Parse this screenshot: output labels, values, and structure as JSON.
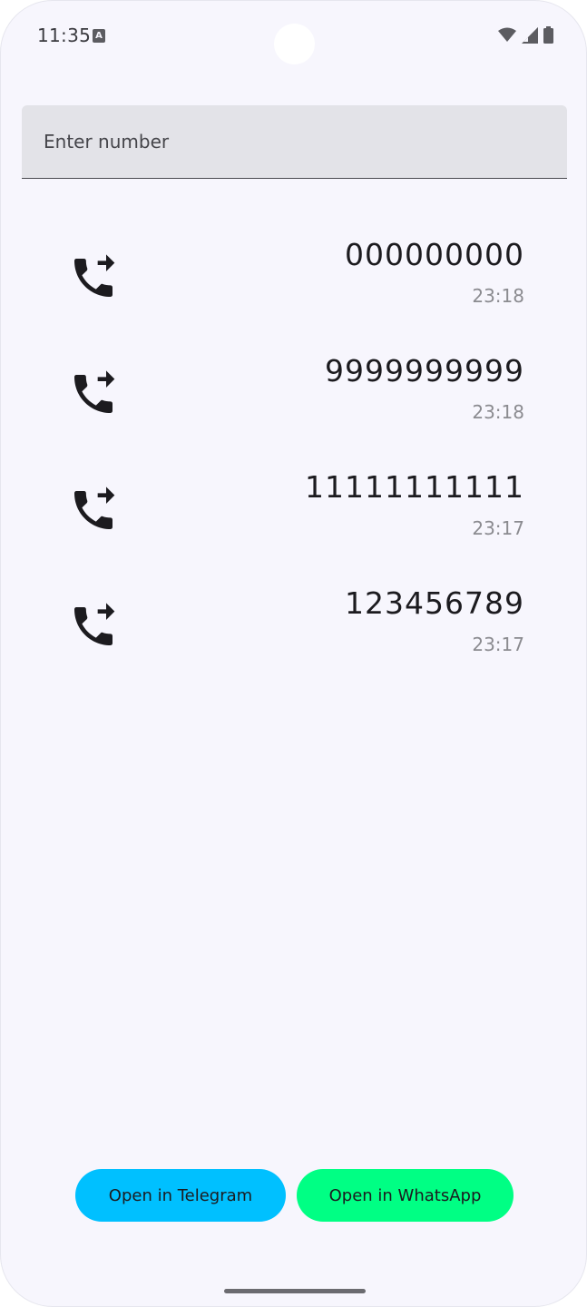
{
  "status_bar": {
    "time": "11:35",
    "notification_icon": "A",
    "icons": [
      "wifi-icon",
      "signal-icon",
      "battery-icon"
    ]
  },
  "number_input": {
    "placeholder": "Enter number",
    "value": ""
  },
  "calls": [
    {
      "number": "000000000",
      "time": "23:18",
      "icon": "outgoing-call-icon"
    },
    {
      "number": "9999999999",
      "time": "23:18",
      "icon": "outgoing-call-icon"
    },
    {
      "number": "11111111111",
      "time": "23:17",
      "icon": "outgoing-call-icon"
    },
    {
      "number": "123456789",
      "time": "23:17",
      "icon": "outgoing-call-icon"
    }
  ],
  "buttons": {
    "telegram_label": "Open in Telegram",
    "whatsapp_label": "Open in WhatsApp"
  },
  "colors": {
    "background": "#f7f6fd",
    "telegram": "#00c0ff",
    "whatsapp": "#00ff84",
    "time_text": "#8b8b90"
  }
}
